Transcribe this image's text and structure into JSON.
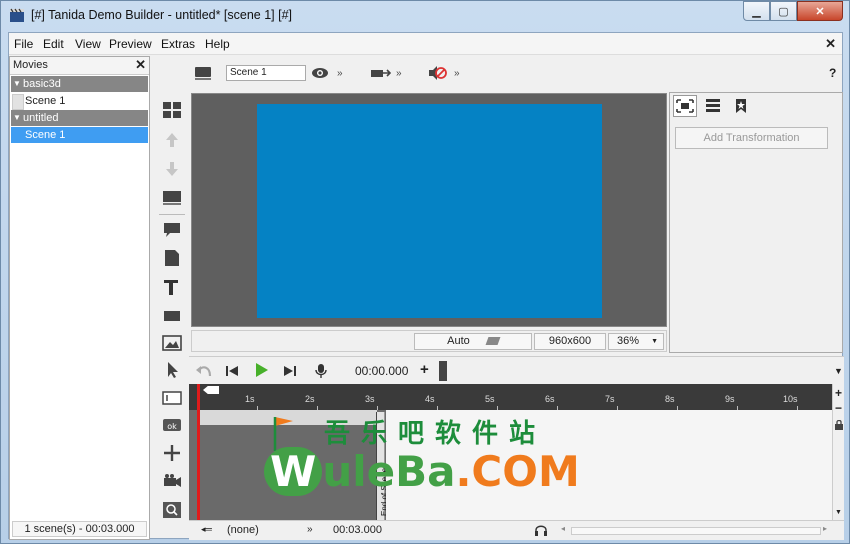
{
  "window": {
    "title": "[#] Tanida Demo Builder - untitled* [scene 1] [#]",
    "min_glyph": "▁",
    "max_glyph": "▢",
    "close_glyph": "✕"
  },
  "menu": {
    "items": [
      "File",
      "Edit",
      "View",
      "Preview",
      "Extras",
      "Help"
    ],
    "close_glyph": "✕"
  },
  "movies": {
    "header": "Movies",
    "close_glyph": "✕",
    "groups": [
      {
        "name": "basic3d",
        "scenes": [
          "Scene 1"
        ]
      },
      {
        "name": "untitled",
        "scenes": [
          "Scene 1"
        ]
      }
    ],
    "status": "1 scene(s) - 00:03.000"
  },
  "toolbar": {
    "scene_name": "Scene 1",
    "help_glyph": "?"
  },
  "stage": {
    "canvas_color": "#0582c4",
    "status": {
      "mode": "Auto",
      "resolution": "960x600",
      "zoom": "36%"
    }
  },
  "right_panel": {
    "add_transformation": "Add Transformation"
  },
  "playback": {
    "time": "00:00.000",
    "add_glyph": "+"
  },
  "timeline": {
    "ticks": [
      "1s",
      "2s",
      "3s",
      "4s",
      "5s",
      "6s",
      "7s",
      "8s",
      "9s",
      "10s"
    ],
    "end_of_scene": "End of Scene",
    "zoom_in": "+",
    "zoom_out": "−"
  },
  "bottom": {
    "transition": "(none)",
    "duration": "00:03.000"
  },
  "watermark": {
    "chinese": "吾乐吧软件站",
    "w": "W",
    "ule": "uleBa",
    "com": ".COM"
  }
}
